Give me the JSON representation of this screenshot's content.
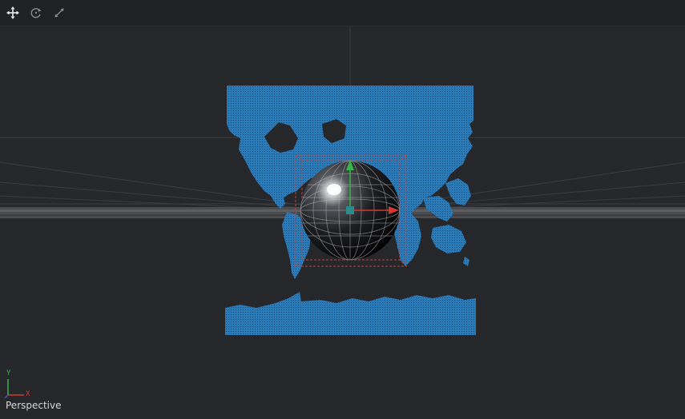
{
  "toolbar": {
    "tools": [
      {
        "name": "transform-tool",
        "icon": "move-arrows-icon"
      },
      {
        "name": "rotate-tool",
        "icon": "rotate-icon"
      },
      {
        "name": "scale-tool",
        "icon": "scale-arrow-icon"
      }
    ]
  },
  "viewport": {
    "view_label": "Perspective",
    "axis_labels": {
      "y": "Y",
      "x": "X"
    },
    "colors": {
      "background": "#26272b",
      "map_blue": "#2f78b3",
      "bounding_box": "#c0443c",
      "axis_x": "#d23a32",
      "axis_y": "#39b34a",
      "axis_z": "#3f55c8"
    }
  }
}
